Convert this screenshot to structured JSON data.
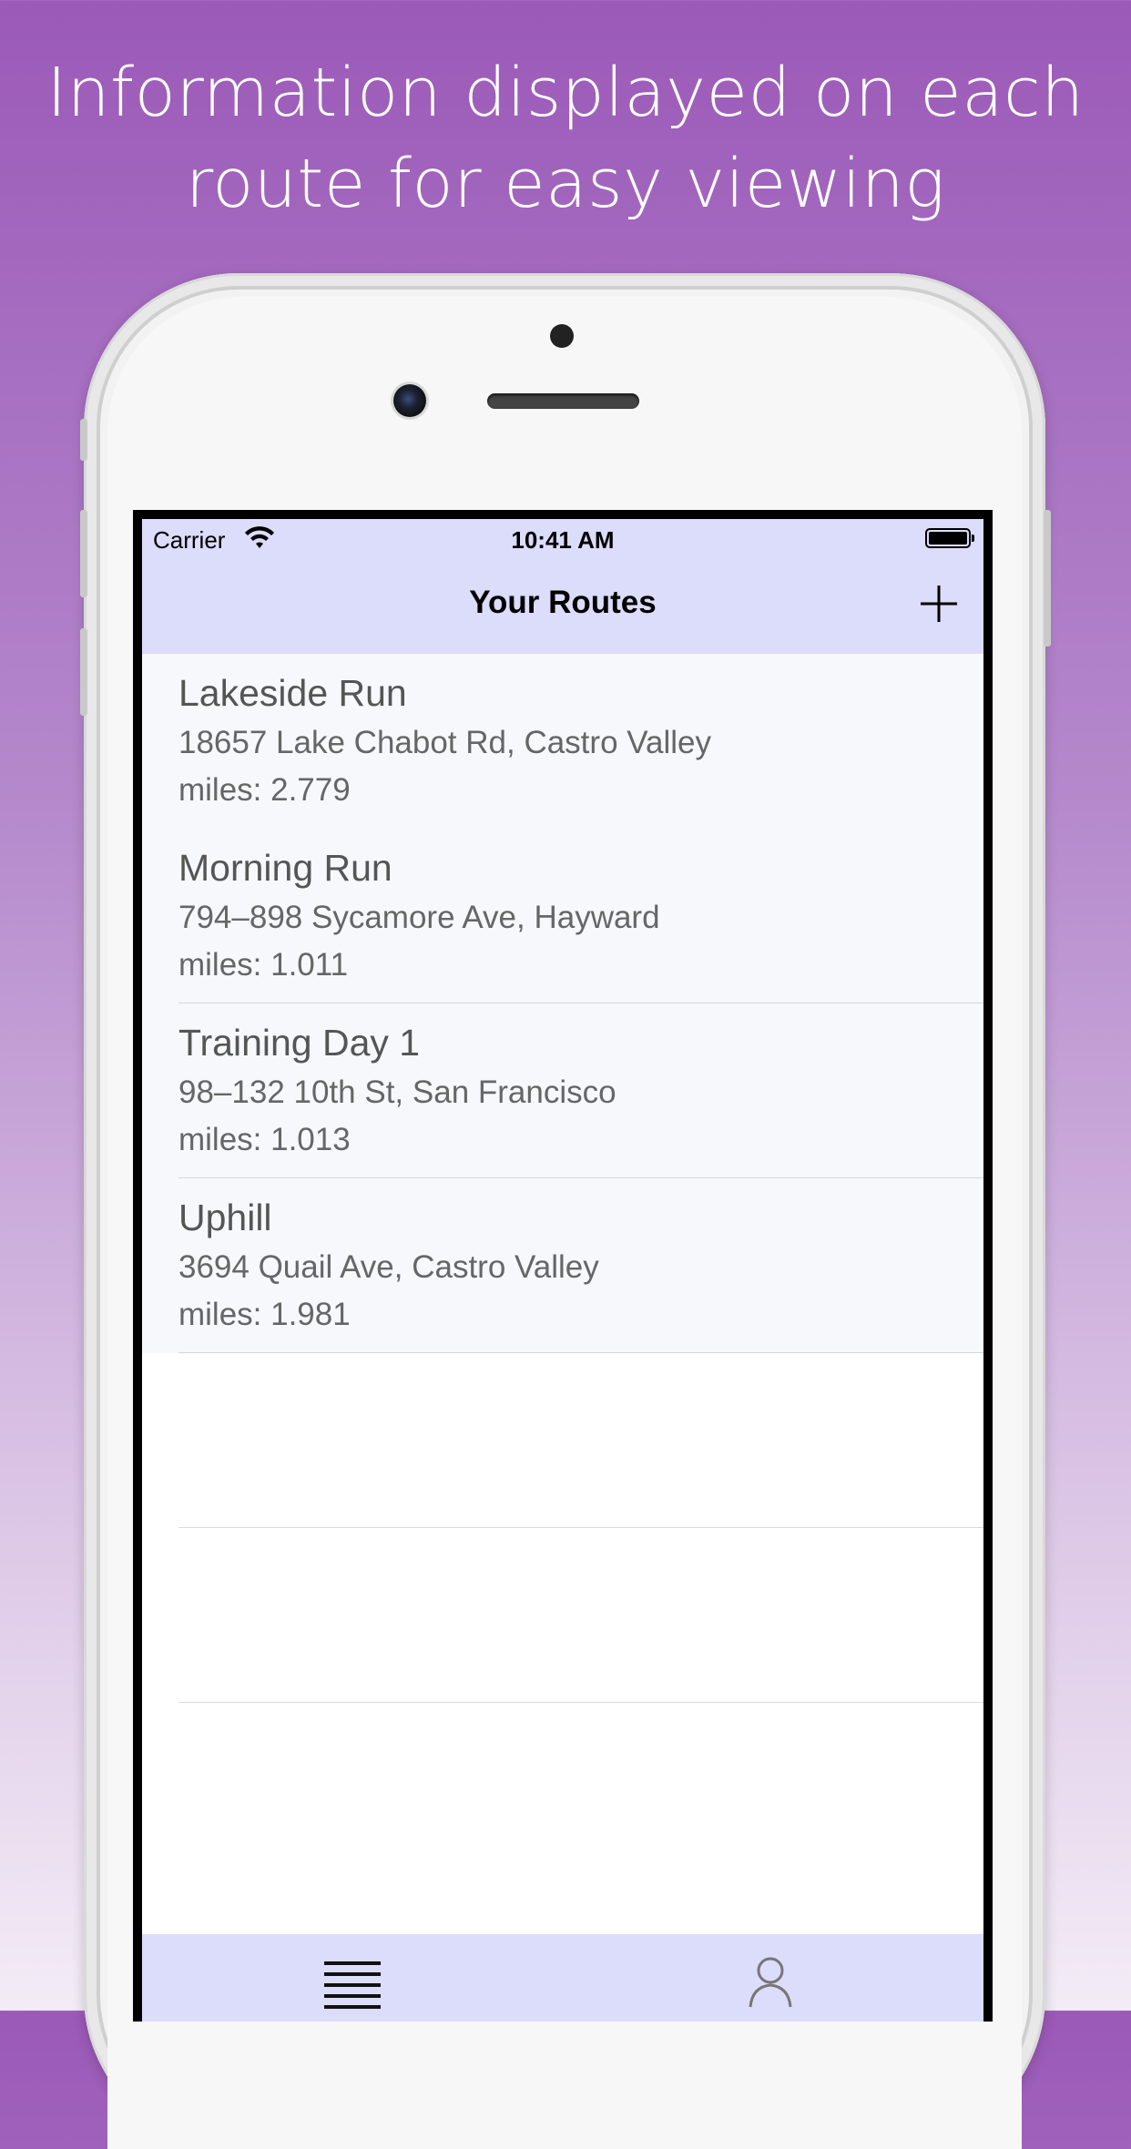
{
  "headline": {
    "line1": "Information displayed on each",
    "line2": "route for easy viewing"
  },
  "status_bar": {
    "carrier": "Carrier",
    "time": "10:41 AM",
    "icons": [
      "wifi-icon",
      "battery-icon"
    ]
  },
  "nav": {
    "title": "Your Routes",
    "add_icon": "plus-icon"
  },
  "routes": [
    {
      "name": "Lakeside Run",
      "address": "18657 Lake Chabot Rd, Castro Valley",
      "miles": "miles: 2.779"
    },
    {
      "name": "Morning Run",
      "address": "794–898 Sycamore Ave, Hayward",
      "miles": "miles: 1.011"
    },
    {
      "name": "Training Day 1",
      "address": "98–132 10th St, San Francisco",
      "miles": "miles: 1.013"
    },
    {
      "name": "Uphill",
      "address": "3694 Quail Ave, Castro Valley",
      "miles": "miles: 1.981"
    }
  ],
  "tabbar": {
    "tabs": [
      {
        "icon": "list-icon"
      },
      {
        "icon": "profile-icon"
      }
    ]
  },
  "colors": {
    "background_top": "#9b59b8",
    "nav_bar": "#dcdcfb",
    "row_bg": "#f7f8fc"
  }
}
